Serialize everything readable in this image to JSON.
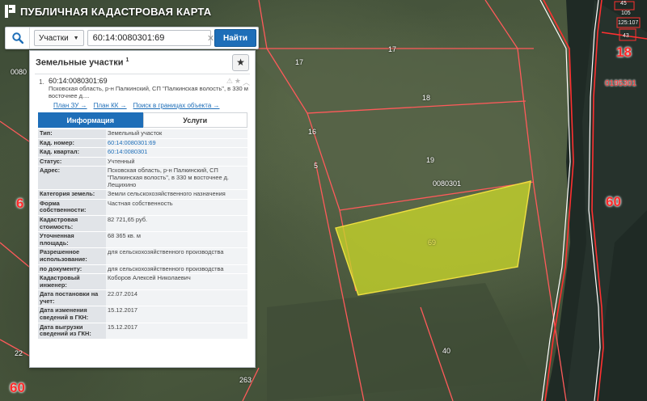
{
  "app": {
    "title": "ПУБЛИЧНАЯ КАДАСТРОВАЯ КАРТА"
  },
  "search": {
    "scope": "Участки",
    "query": "60:14:0080301:69",
    "find_label": "Найти"
  },
  "panel": {
    "title": "Земельные участки",
    "count": "1",
    "result": {
      "index": "1.",
      "cad_number": "60:14:0080301:69",
      "address": "Псковская область, р-н Палкинский, СП \"Палкинская волость\", в 330 м восточнее д....",
      "links": [
        "План ЗУ →",
        "План КК →",
        "Поиск в границах объекта →"
      ]
    },
    "tabs": [
      "Информация",
      "Услуги"
    ],
    "info": [
      {
        "label": "Тип:",
        "value": "Земельный участок",
        "link": false
      },
      {
        "label": "Кад. номер:",
        "value": "60:14:0080301:69",
        "link": true
      },
      {
        "label": "Кад. квартал:",
        "value": "60:14:0080301",
        "link": true
      },
      {
        "label": "Статус:",
        "value": "Учтенный",
        "link": false
      },
      {
        "label": "Адрес:",
        "value": "Псковская область, р-н Палкинский, СП \"Палкинская волость\", в 330 м восточнее д. Лещихино",
        "link": false
      },
      {
        "label": "Категория земель:",
        "value": "Земли сельскохозяйственного назначения",
        "link": false
      },
      {
        "label": "Форма собственности:",
        "value": "Частная собственность",
        "link": false
      },
      {
        "label": "Кадастровая стоимость:",
        "value": "82 721,65 руб.",
        "link": false
      },
      {
        "label": "Уточненная площадь:",
        "value": "68 365 кв. м",
        "link": false
      },
      {
        "label": "Разрешенное использование:",
        "value": "для сельскохозяйственного производства",
        "link": false
      },
      {
        "label": "по документу:",
        "value": "для сельскохозяйственного производства",
        "link": false
      },
      {
        "label": "Кадастровый инженер:",
        "value": "Коборов Алексей Николаевич",
        "link": false
      },
      {
        "label": "Дата постановки на учет:",
        "value": "22.07.2014",
        "link": false
      },
      {
        "label": "Дата изменения сведений в ГКН:",
        "value": "15.12.2017",
        "link": false
      },
      {
        "label": "Дата выгрузки сведений из ГКН:",
        "value": "15.12.2017",
        "link": false
      }
    ]
  },
  "map": {
    "labels": [
      "17",
      "17",
      "18",
      "16",
      "19",
      "5",
      "40",
      "22",
      "263",
      "0080301",
      "69",
      "0080",
      "60",
      "6",
      "18",
      "60",
      "0195301",
      "43",
      "105",
      "125:107",
      "45"
    ]
  },
  "colors": {
    "accent": "#1e6eb8",
    "parcel_fill": "#c8d62a",
    "boundary": "#ff2020"
  }
}
